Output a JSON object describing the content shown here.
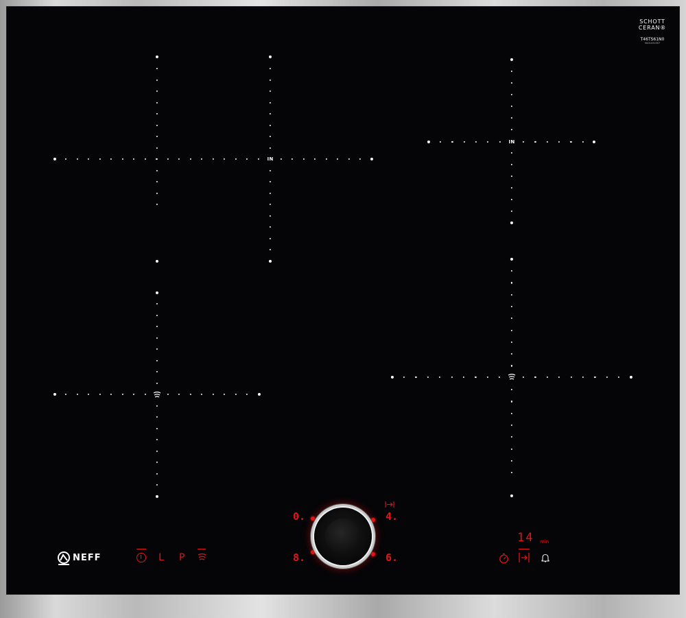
{
  "glass_brand": {
    "line1": "SCHOTT",
    "line2": "CERAN®",
    "model": "T46TS61N0",
    "serial": "9001031957"
  },
  "zones": {
    "zone_a_label": "IN",
    "zone_c_label": "IN"
  },
  "controls": {
    "brand_name": "NEFF",
    "power_symbol": "⏻",
    "lock_label": "L",
    "powerboost_label": "P",
    "fryingsensor_icon": "frying-sensor-icon",
    "level_0": "0.",
    "level_4": "4.",
    "level_8": "8.",
    "level_6": "6.",
    "timer_value": "14",
    "timer_unit": "min",
    "timer_icon": "stopwatch-icon",
    "auto_icon": "auto-cook-icon",
    "alarm_icon": "bell-icon"
  },
  "colors": {
    "control_red": "#e51414",
    "glass": "#050507",
    "trim": "#bdbdbd"
  }
}
